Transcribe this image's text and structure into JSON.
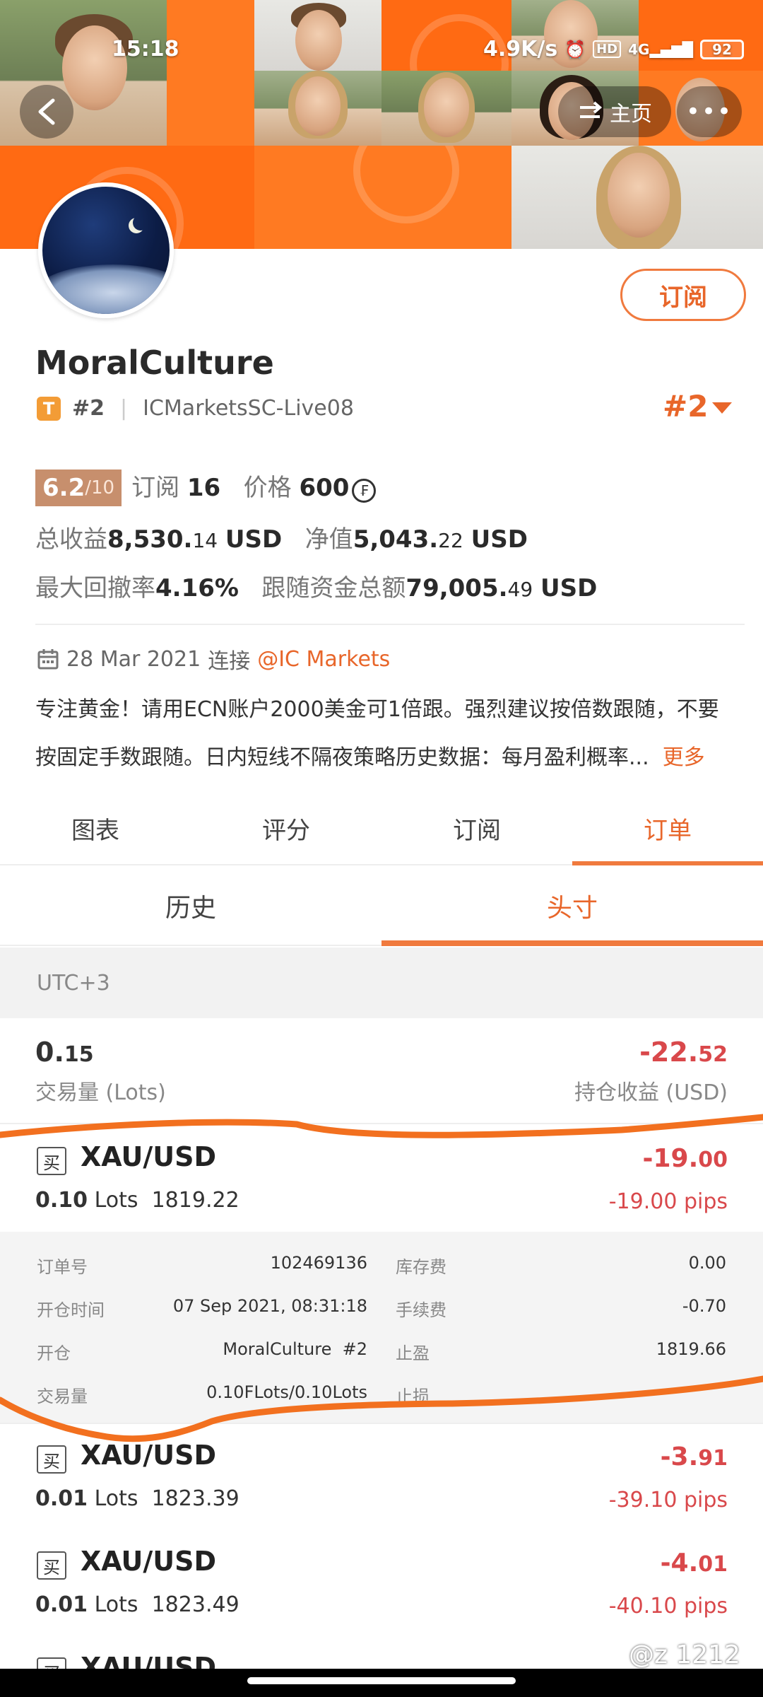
{
  "status_bar": {
    "time": "15:18",
    "speed": "4.9K/s",
    "network": "4G",
    "battery": "92"
  },
  "nav": {
    "home_label": "主页",
    "more_label": "•••"
  },
  "profile": {
    "subscribe_label": "订阅",
    "name": "MoralCulture",
    "tier_badge": "T",
    "rank": "#2",
    "server": "ICMarketsSC-Live08",
    "rank_right": "#2"
  },
  "stats": {
    "score_main": "6.2",
    "score_total": "/10",
    "subscribe_label": "订阅",
    "subscribe_count": "16",
    "price_label": "价格",
    "price_value": "600",
    "coin_symbol": "₣",
    "total_profit_label": "总收益",
    "total_profit_main": "8,530.",
    "total_profit_dec": "14",
    "total_profit_unit": "USD",
    "equity_label": "净值",
    "equity_main": "5,043.",
    "equity_dec": "22",
    "equity_unit": "USD",
    "max_dd_label": "最大回撤率",
    "max_dd_value": "4.16%",
    "follow_label": "跟随资金总额",
    "follow_main": "79,005.",
    "follow_dec": "49",
    "follow_unit": "USD"
  },
  "connection": {
    "date": "28 Mar 2021",
    "connect_label": "连接",
    "broker": "@IC Markets"
  },
  "description": {
    "line1": "专注黄金！请用ECN账户2000美金可1倍跟。强烈建议按倍数跟随，不要",
    "line2": "按固定手数跟随。日内短线不隔夜策略历史数据：每月盈利概率...",
    "more": "更多"
  },
  "tabs": [
    "图表",
    "评分",
    "订阅",
    "订单"
  ],
  "subtabs": [
    "历史",
    "头寸"
  ],
  "timezone": "UTC+3",
  "summary": {
    "volume_main": "0.",
    "volume_dec": "15",
    "volume_label": "交易量 (Lots)",
    "profit_main": "-22.",
    "profit_dec": "52",
    "profit_label": "持仓收益 (USD)"
  },
  "orders": [
    {
      "side": "买",
      "symbol": "XAU/USD",
      "lots": "0.10",
      "lots_unit": "Lots",
      "price": "1819.22",
      "pl_main": "-19.",
      "pl_dec": "00",
      "pips": "-19.00 pips"
    },
    {
      "side": "买",
      "symbol": "XAU/USD",
      "lots": "0.01",
      "lots_unit": "Lots",
      "price": "1823.39",
      "pl_main": "-3.",
      "pl_dec": "91",
      "pips": "-39.10 pips"
    },
    {
      "side": "买",
      "symbol": "XAU/USD",
      "lots": "0.01",
      "lots_unit": "Lots",
      "price": "1823.49",
      "pl_main": "-4.",
      "pl_dec": "01",
      "pips": "-40.10 pips"
    },
    {
      "side": "买",
      "symbol": "XAU/USD"
    }
  ],
  "order_detail": {
    "order_no_label": "订单号",
    "order_no": "102469136",
    "swap_label": "库存费",
    "swap": "0.00",
    "open_time_label": "开仓时间",
    "open_time": "07 Sep 2021, 08:31:18",
    "fee_label": "手续费",
    "fee": "-0.70",
    "open_label": "开仓",
    "open_by": "MoralCulture  #2",
    "tp_label": "止盈",
    "tp": "1819.66",
    "volume_label": "交易量",
    "volume": "0.10FLots/0.10Lots",
    "sl_label": "止损"
  },
  "watermark": "@z 1212",
  "colors": {
    "accent": "#e8662a",
    "loss": "#d9484b",
    "banner": "#ff6a13",
    "annotation": "#f2701f"
  }
}
